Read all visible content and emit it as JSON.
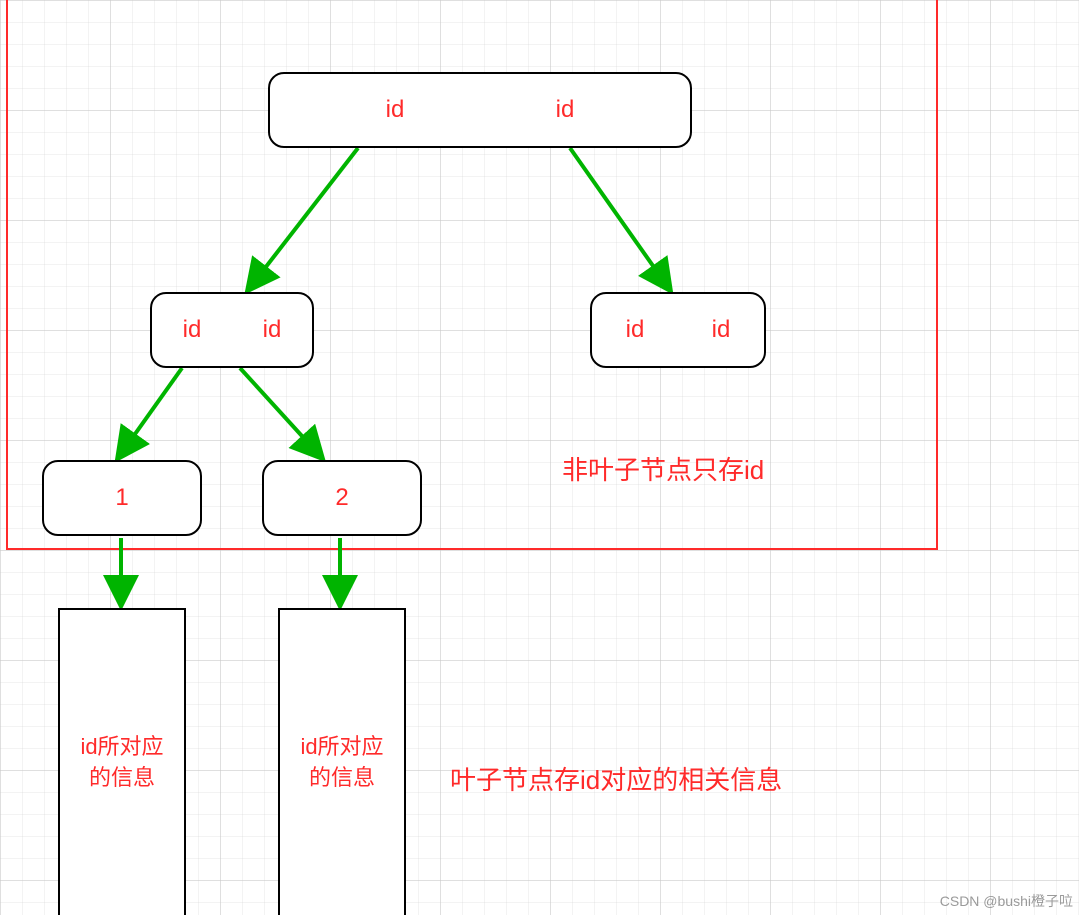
{
  "root": {
    "left_label": "id",
    "right_label": "id"
  },
  "mid_left": {
    "left_label": "id",
    "right_label": "id"
  },
  "mid_right": {
    "left_label": "id",
    "right_label": "id"
  },
  "small_left": {
    "label": "1"
  },
  "small_right": {
    "label": "2"
  },
  "leaf_left": {
    "line1": "id所对应",
    "line2": "的信息"
  },
  "leaf_right": {
    "line1": "id所对应",
    "line2": "的信息"
  },
  "annotations": {
    "non_leaf": "非叶子节点只存id",
    "leaf": "叶子节点存id对应的相关信息"
  },
  "watermark": "CSDN @bushi橙子㕸"
}
